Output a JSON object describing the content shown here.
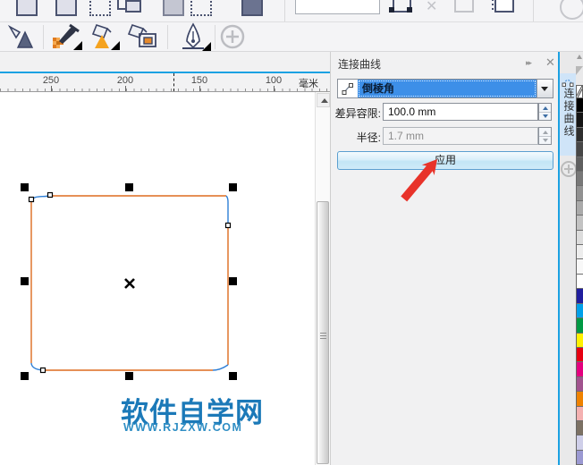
{
  "property_bar": {
    "input_value": "",
    "icons": [
      "box-icon",
      "box-icon",
      "dashed-box-icon",
      "overlap-rects-icon",
      "filled-box-icon",
      "dashed-box-icon",
      "dark-box-icon",
      "snap-nodes-icon",
      "delete-x-icon",
      "group-box-icon",
      "properties-icon",
      "help-icon"
    ]
  },
  "toolbox": {
    "icons": [
      "smart-fill-tool",
      "color-eyedropper-tool",
      "fill-tool",
      "interactive-fill-tool",
      "pen-tool",
      "add-tool"
    ]
  },
  "ruler": {
    "ticks": [
      "250",
      "200",
      "150",
      "100"
    ],
    "unit": "毫米"
  },
  "docker": {
    "title": "连接曲线",
    "collapse_icon": "▸▸",
    "close_icon": "✕",
    "preset_value": "倒棱角",
    "rows": [
      {
        "label": "差异容限:",
        "value": "100.0 mm"
      },
      {
        "label": "半径:",
        "value": "1.7 mm"
      }
    ],
    "apply_label": "应用"
  },
  "side_tab": {
    "label": "连接曲线"
  },
  "palette": {
    "swatches": [
      "#000000",
      "#151515",
      "#2e2e2e",
      "#474747",
      "#5f5f5f",
      "#787878",
      "#919191",
      "#aaaaaa",
      "#c3c3c3",
      "#dcdcdc",
      "#ededed",
      "#f8f8f8",
      "#ffffff",
      "#201e9e",
      "#00a0e9",
      "#009944",
      "#fff100",
      "#e60012",
      "#e4007f",
      "#a1538e",
      "#ef8200",
      "#f4b1b1",
      "#7c7164",
      "#cfcfe9",
      "#9b99d2"
    ]
  },
  "watermark": {
    "title": "软件自学网",
    "url": "WWW.RJZXW.COM"
  },
  "theme": {
    "accent": "#1ba1e2",
    "shape_stroke": "#dd6b1e",
    "corner_stroke": "#2e7fd6",
    "arrow": "#e8332a",
    "highlight": "#3d8fe8",
    "watermark_title": "#1b79b8",
    "watermark_url": "#2f8ec4"
  }
}
